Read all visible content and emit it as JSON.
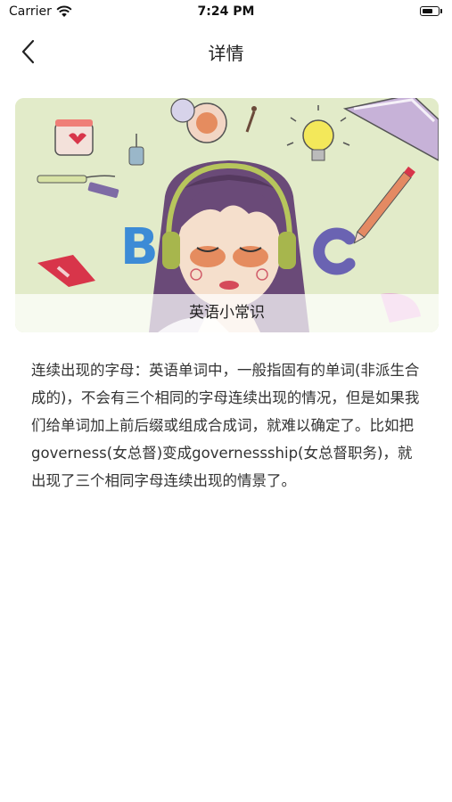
{
  "status_bar": {
    "carrier": "Carrier",
    "time": "7:24 PM",
    "battery_level": 0.7
  },
  "nav": {
    "title": "详情",
    "back_icon": "chevron-left-icon"
  },
  "banner": {
    "caption": "英语小常识"
  },
  "article": {
    "text": "连续出现的字母：英语单词中，一般指固有的单词(非派生合成的)，不会有三个相同的字母连续出现的情况，但是如果我们给单词加上前后缀或组成合成词，就难以确定了。比如把governess(女总督)变成governessship(女总督职务)，就出现了三个相同字母连续出现的情景了。"
  }
}
